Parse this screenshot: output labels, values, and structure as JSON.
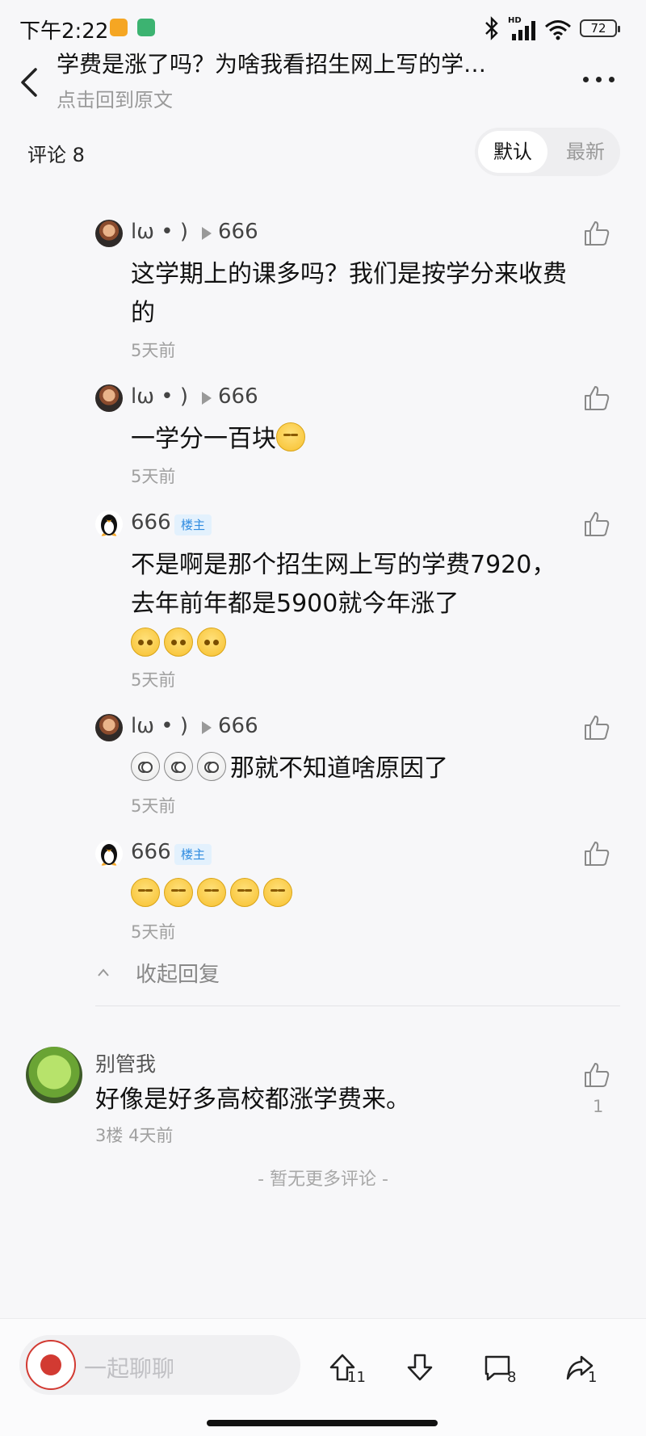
{
  "status_bar": {
    "time": "下午2:22",
    "network": "HD",
    "battery": "72"
  },
  "header": {
    "title": "学费是涨了吗？为啥我看招生网上写的学…",
    "subtitle": "点击回到原文"
  },
  "comments_header": {
    "label": "评论 8",
    "sort_default": "默认",
    "sort_latest": "最新"
  },
  "replies": [
    {
      "name": "lω • )",
      "target": "666",
      "text": "这学期上的课多吗？我们是按学分来收费的",
      "time": "5天前"
    },
    {
      "name": "lω • )",
      "target": "666",
      "text": "一学分一百块",
      "time": "5天前"
    },
    {
      "name": "666",
      "badge": "楼主",
      "text": "不是啊是那个招生网上写的学费7920，去年前年都是5900就今年涨了",
      "time": "5天前"
    },
    {
      "name": "lω • )",
      "target": "666",
      "text": "那就不知道啥原因了",
      "time": "5天前"
    },
    {
      "name": "666",
      "badge": "楼主",
      "text": "",
      "time": "5天前"
    }
  ],
  "collapse_label": "收起回复",
  "floor_comment": {
    "name": "别管我",
    "text": "好像是好多高校都涨学费来。",
    "floor": "3楼",
    "time": "4天前",
    "likes": "1"
  },
  "no_more": "- 暂无更多评论 -",
  "bottom_bar": {
    "placeholder": "一起聊聊",
    "upvotes": "11",
    "comments": "8",
    "shares": "1"
  }
}
